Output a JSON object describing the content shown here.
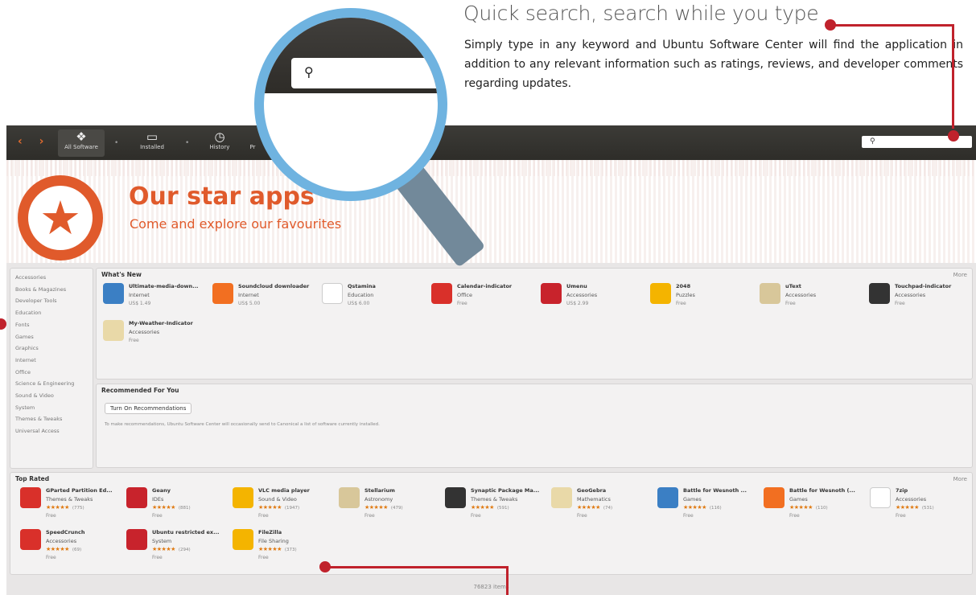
{
  "annotation": {
    "title": "Quick search, search while you type",
    "description": "Simply type in any keyword and Ubuntu Software Center will find the application in addition to any relevant information such as ratings, reviews, and developer comments regarding updates.",
    "accent_color": "#c0222c"
  },
  "toolbar": {
    "back_forward_icon": "back-forward-arrows",
    "items": [
      {
        "label": "All Software",
        "icon": "all-software-icon"
      },
      {
        "label": "Installed",
        "icon": "monitor-icon"
      },
      {
        "label": "History",
        "icon": "clock-icon"
      },
      {
        "label": "Pr",
        "icon": "progress-icon"
      }
    ],
    "search_icon": "search-icon",
    "search_value": ""
  },
  "banner": {
    "title": "Our star apps",
    "subtitle": "Come and explore our favourites",
    "accent_color": "#e05a2b"
  },
  "categories": [
    "Accessories",
    "Books & Magazines",
    "Developer Tools",
    "Education",
    "Fonts",
    "Games",
    "Graphics",
    "Internet",
    "Office",
    "Science & Engineering",
    "Sound & Video",
    "System",
    "Themes & Tweaks",
    "Universal Access"
  ],
  "whats_new": {
    "title": "What's New",
    "more": "More",
    "apps": [
      {
        "name": "Ultimate-media-down...",
        "category": "Internet",
        "price": "US$ 1.49"
      },
      {
        "name": "Soundcloud downloader",
        "category": "Internet",
        "price": "US$ 5.00"
      },
      {
        "name": "Qstamina",
        "category": "Education",
        "price": "US$ 6.00"
      },
      {
        "name": "Calendar-indicator",
        "category": "Office",
        "price": "Free"
      },
      {
        "name": "Umenu",
        "category": "Accessories",
        "price": "US$ 2.99"
      },
      {
        "name": "2048",
        "category": "Puzzles",
        "price": "Free"
      },
      {
        "name": "uText",
        "category": "Accessories",
        "price": "Free"
      },
      {
        "name": "Touchpad-indicator",
        "category": "Accessories",
        "price": "Free"
      },
      {
        "name": "My-Weather-Indicator",
        "category": "Accessories",
        "price": "Free"
      }
    ]
  },
  "recommended": {
    "title": "Recommended For You",
    "button": "Turn On Recommendations",
    "text": "To make recommendations, Ubuntu Software Center will occasionally send to Canonical a list of software currently installed."
  },
  "top_rated": {
    "title": "Top Rated",
    "more": "More",
    "apps": [
      {
        "name": "GParted Partition Ed...",
        "category": "Themes & Tweaks",
        "stars": "★★★★★",
        "count": "(775)",
        "price": "Free"
      },
      {
        "name": "Geany",
        "category": "IDEs",
        "stars": "★★★★★",
        "count": "(881)",
        "price": "Free"
      },
      {
        "name": "VLC media player",
        "category": "Sound & Video",
        "stars": "★★★★★",
        "count": "(1947)",
        "price": "Free"
      },
      {
        "name": "Stellarium",
        "category": "Astronomy",
        "stars": "★★★★★",
        "count": "(479)",
        "price": "Free"
      },
      {
        "name": "Synaptic Package Ma...",
        "category": "Themes & Tweaks",
        "stars": "★★★★★",
        "count": "(591)",
        "price": "Free"
      },
      {
        "name": "GeoGebra",
        "category": "Mathematics",
        "stars": "★★★★★",
        "count": "(74)",
        "price": "Free"
      },
      {
        "name": "Battle for Wesnoth ...",
        "category": "Games",
        "stars": "★★★★★",
        "count": "(116)",
        "price": "Free"
      },
      {
        "name": "Battle for Wesnoth (...",
        "category": "Games",
        "stars": "★★★★★",
        "count": "(110)",
        "price": "Free"
      },
      {
        "name": "7zip",
        "category": "Accessories",
        "stars": "★★★★★",
        "count": "(531)",
        "price": "Free"
      },
      {
        "name": "SpeedCrunch",
        "category": "Accessories",
        "stars": "★★★★★",
        "count": "(69)",
        "price": "Free"
      },
      {
        "name": "Ubuntu restricted ex...",
        "category": "System",
        "stars": "★★★★★",
        "count": "(294)",
        "price": "Free"
      },
      {
        "name": "FileZilla",
        "category": "File Sharing",
        "stars": "★★★★★",
        "count": "(373)",
        "price": "Free"
      }
    ],
    "items_count": "76823 items"
  }
}
